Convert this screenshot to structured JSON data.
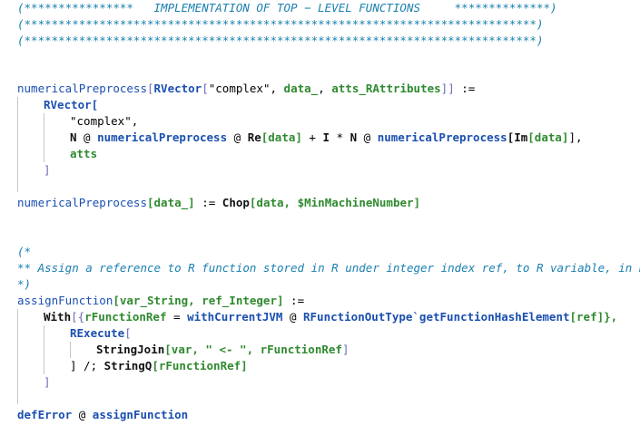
{
  "code": {
    "header_comment": [
      "(****************   IMPLEMENTATION OF TOP − LEVEL FUNCTIONS     **************)",
      "(***************************************************************************)",
      "(***************************************************************************)"
    ],
    "block1": {
      "l1_fn": "numericalPreprocess",
      "l1_open": "[",
      "l1_head": "RVector",
      "l1_b": "[",
      "l1_str": "\"complex\"",
      "l1_comma": ", ",
      "l1_data": "data_",
      "l1_comma2": ", ",
      "l1_atts": "atts_RAttributes",
      "l1_close": "]]",
      "l1_assign": " :=",
      "l2": "RVector[",
      "l3": "\"complex\",",
      "l4_n": "N",
      "l4_at": " @ ",
      "l4_fn": "numericalPreprocess",
      "l4_at2": " @ ",
      "l4_re": "Re",
      "l4_data": "[data]",
      "l4_plus": " + ",
      "l4_i": "I",
      "l4_star": " * ",
      "l4_n2": "N",
      "l4_at3": " @ ",
      "l4_fn2": "numericalPreprocess",
      "l4_im": "[Im",
      "l4_data2": "[data]",
      "l4_end": "],",
      "l5": "atts",
      "l6": "]"
    },
    "block2": {
      "fn": "numericalPreprocess",
      "arg": "[data_]",
      "assign": " := ",
      "chop": "Chop",
      "args": "[data, $MinMachineNumber]"
    },
    "comment2": [
      "(*",
      "** Assign a reference to R function stored in R under integer index ref, to R variable, in R",
      "*)"
    ],
    "block3": {
      "fn": "assignFunction",
      "sig": "[var_String, ref_Integer]",
      "assign": " :=",
      "with": "With",
      "with_open": "[{",
      "rref": "rFunctionRef",
      "eq": " = ",
      "jvm": "withCurrentJVM",
      "at": " @ ",
      "otype": "RFunctionOutType`getFunctionHashElement",
      "ref": "[ref]},",
      "rexec": "RExecute",
      "rexec_open": "[",
      "sjoin": "StringJoin",
      "sjoin_args_a": "[var, \" <- \", ",
      "sjoin_rref": "rFunctionRef",
      "sjoin_close": "]",
      "close_line": "] /; ",
      "stringq": "StringQ",
      "stringq_args": "[rFunctionRef]",
      "final_close": "]"
    },
    "block4": {
      "deferror": "defError",
      "at": " @ ",
      "fn": "assignFunction"
    }
  }
}
